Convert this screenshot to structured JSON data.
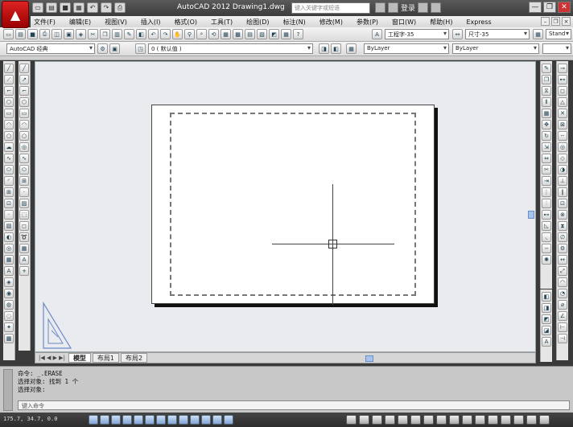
{
  "window": {
    "title": "AutoCAD 2012  Drawing1.dwg",
    "search_placeholder": "键入关键字或短语",
    "signin_label": "登录",
    "controls": [
      "—",
      "❐",
      "✕"
    ]
  },
  "menu": {
    "items": [
      "文件(F)",
      "编辑(E)",
      "视图(V)",
      "插入(I)",
      "格式(O)",
      "工具(T)",
      "绘图(D)",
      "标注(N)",
      "修改(M)",
      "参数(P)",
      "窗口(W)",
      "帮助(H)",
      "Express"
    ]
  },
  "toolbar": {
    "workspace": "AutoCAD 经典",
    "layer": "0  ( 默认值 )",
    "text_style": "工程字-35",
    "dim_style": "尺寸-35",
    "table_style": "Stand",
    "color": "ByLayer",
    "linetype": "ByLayer"
  },
  "tabs": {
    "nav": "|◀ ◀ ▶ ▶|",
    "items": [
      "模型",
      "布局1",
      "布局2"
    ],
    "active": "模型"
  },
  "command": {
    "lines": [
      "命令:  _.ERASE",
      "选择对象:  找到 1 个",
      "选择对象:"
    ],
    "input_placeholder": "键入命令"
  },
  "status": {
    "coords": "175.7,  34.7,  0.0"
  },
  "colors": {
    "canvas": "#e9ebee",
    "paper": "#ffffff",
    "titlebar": "#3c3c3c"
  }
}
